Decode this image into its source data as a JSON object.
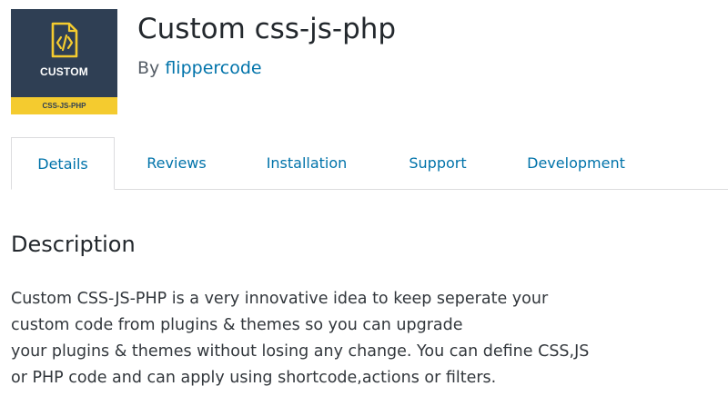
{
  "icon": {
    "name": "code-document-icon",
    "word": "CUSTOM",
    "band": "CSS-JS-PHP",
    "background_color": "#2f3f54",
    "accent_color": "#f4cb2f"
  },
  "header": {
    "title": "Custom css-js-php",
    "by_prefix": "By",
    "author": "flippercode"
  },
  "tabs": [
    {
      "label": "Details",
      "active": true
    },
    {
      "label": "Reviews",
      "active": false
    },
    {
      "label": "Installation",
      "active": false
    },
    {
      "label": "Support",
      "active": false
    },
    {
      "label": "Development",
      "active": false
    }
  ],
  "description": {
    "heading": "Description",
    "lines": [
      "Custom CSS-JS-PHP is a very innovative idea to keep seperate your",
      "custom code from plugins & themes so you can upgrade",
      "your plugins & themes without losing any change. You can define CSS,JS",
      "or PHP code and can apply using shortcode,actions or filters."
    ]
  },
  "colors": {
    "link": "#0073aa",
    "text": "#23282d"
  }
}
